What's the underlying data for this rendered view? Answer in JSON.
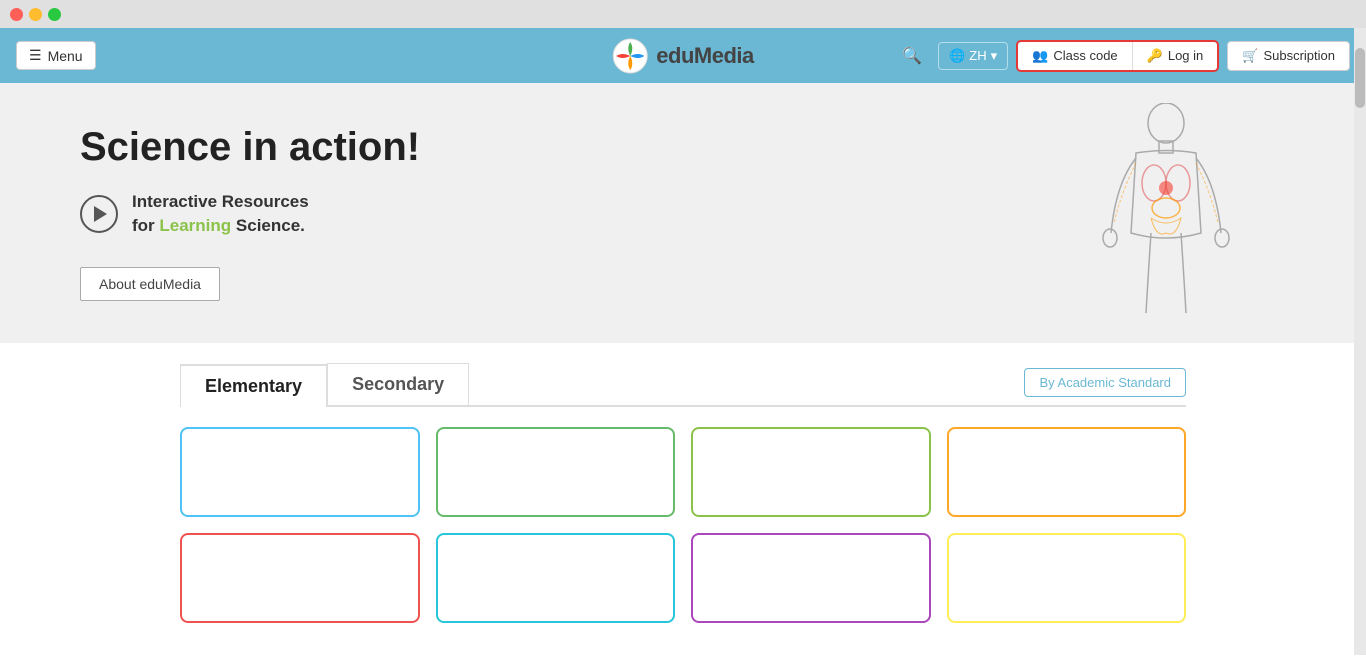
{
  "titlebar": {
    "buttons": [
      "close",
      "minimize",
      "maximize"
    ]
  },
  "navbar": {
    "menu_label": "Menu",
    "logo_text": "eduMedia",
    "search_icon": "🔍",
    "lang_label": "ZH",
    "lang_dropdown_icon": "▾",
    "class_code_label": "Class code",
    "login_label": "Log in",
    "subscription_label": "Subscription"
  },
  "hero": {
    "title": "Science in action!",
    "subtitle_line1": "Interactive Resources",
    "subtitle_line2_prefix": "for ",
    "subtitle_learning": "Learning",
    "subtitle_line2_suffix": " Science.",
    "about_btn_label": "About eduMedia"
  },
  "tabs": {
    "tab1_label": "Elementary",
    "tab2_label": "Secondary",
    "academic_standard_label": "By Academic Standard"
  },
  "cards": {
    "row1": [
      {
        "color": "blue"
      },
      {
        "color": "green-dark"
      },
      {
        "color": "green-bright"
      },
      {
        "color": "orange"
      }
    ],
    "row2": [
      {
        "color": "red"
      },
      {
        "color": "teal"
      },
      {
        "color": "purple"
      },
      {
        "color": "yellow"
      }
    ]
  }
}
